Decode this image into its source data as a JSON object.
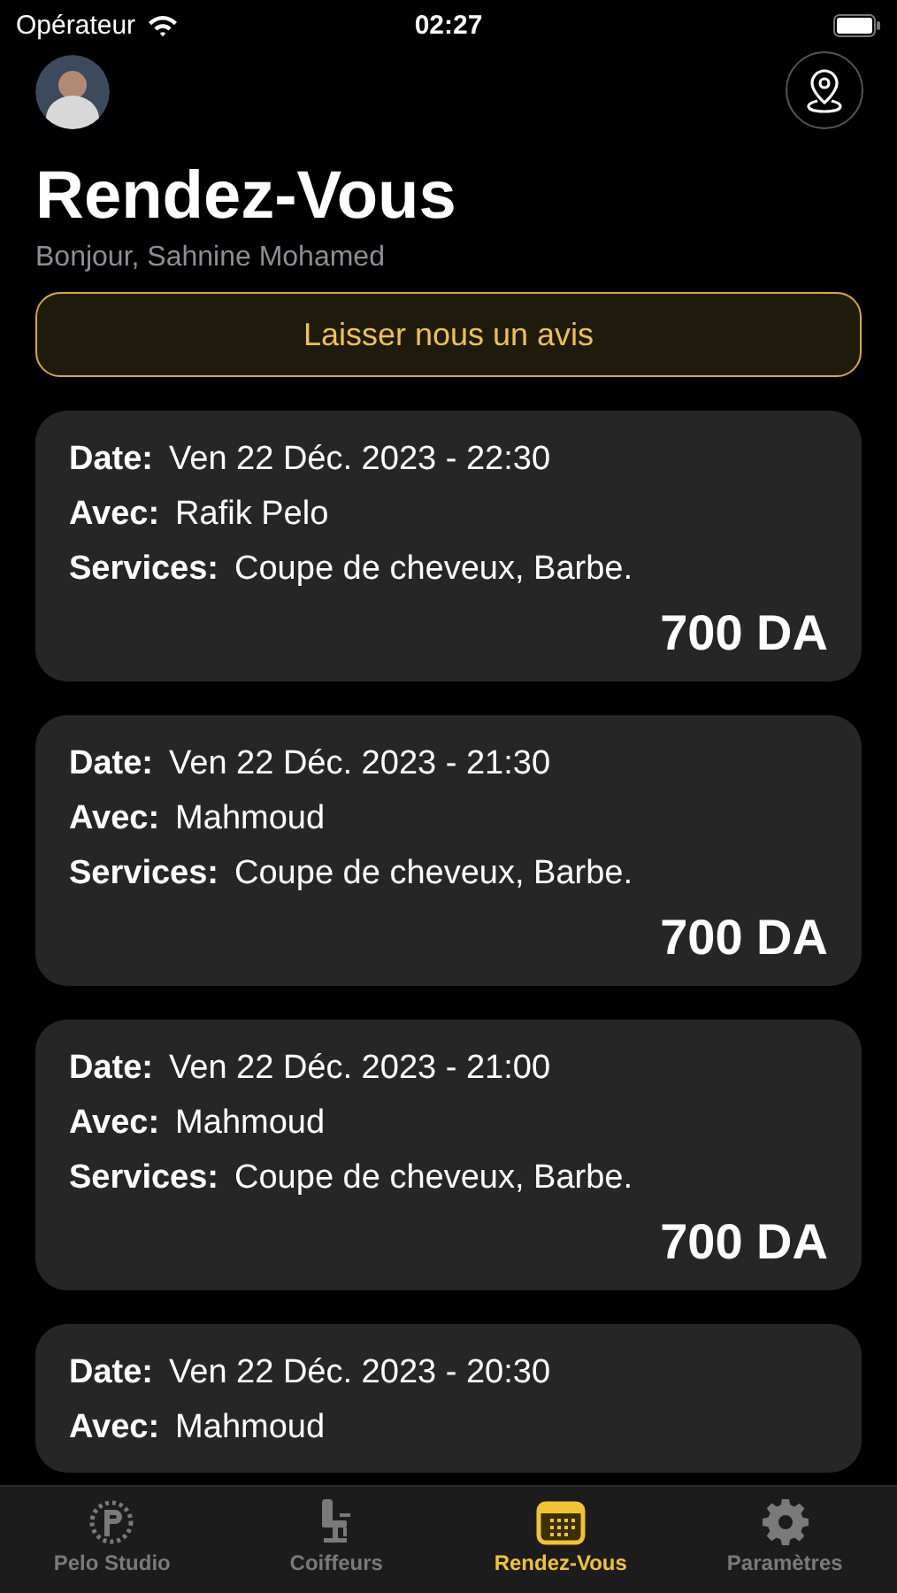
{
  "status_bar": {
    "carrier": "Opérateur",
    "time": "02:27"
  },
  "header": {
    "title": "Rendez-Vous",
    "greeting": "Bonjour, Sahnine Mohamed"
  },
  "review_button": {
    "label": "Laisser nous un avis"
  },
  "appointments": [
    {
      "date_label": "Date:",
      "date": "Ven 22 Déc. 2023 - 22:30",
      "with_label": "Avec:",
      "with": "Rafik Pelo",
      "services_label": "Services:",
      "services": "Coupe de cheveux, Barbe.",
      "price": "700 DA"
    },
    {
      "date_label": "Date:",
      "date": "Ven 22 Déc. 2023 - 21:30",
      "with_label": "Avec:",
      "with": "Mahmoud",
      "services_label": "Services:",
      "services": "Coupe de cheveux, Barbe.",
      "price": "700 DA"
    },
    {
      "date_label": "Date:",
      "date": "Ven 22 Déc. 2023 - 21:00",
      "with_label": "Avec:",
      "with": "Mahmoud",
      "services_label": "Services:",
      "services": "Coupe de cheveux, Barbe.",
      "price": "700 DA"
    },
    {
      "date_label": "Date:",
      "date": "Ven 22 Déc. 2023 - 20:30",
      "with_label": "Avec:",
      "with": "Mahmoud"
    }
  ],
  "tab_bar": [
    {
      "kind": "logo",
      "label": "Pelo Studio",
      "selected": false
    },
    {
      "kind": "chair",
      "label": "Coiffeurs",
      "selected": false
    },
    {
      "kind": "calendar",
      "label": "Rendez-Vous",
      "selected": true
    },
    {
      "kind": "gear",
      "label": "Paramètres",
      "selected": false
    }
  ]
}
